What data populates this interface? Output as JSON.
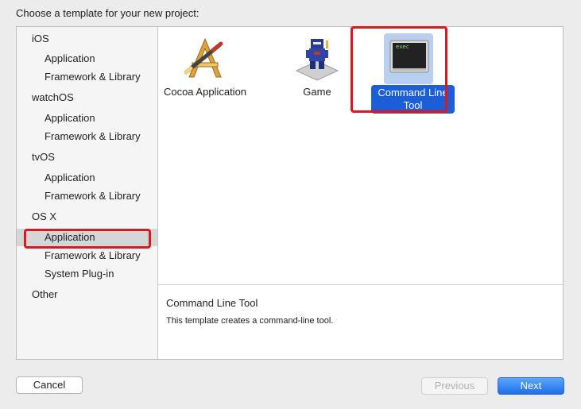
{
  "heading": "Choose a template for your new project:",
  "sidebar": {
    "items": [
      {
        "label": "iOS",
        "kind": "platform"
      },
      {
        "label": "Application",
        "kind": "sub"
      },
      {
        "label": "Framework & Library",
        "kind": "sub"
      },
      {
        "label": "watchOS",
        "kind": "platform"
      },
      {
        "label": "Application",
        "kind": "sub"
      },
      {
        "label": "Framework & Library",
        "kind": "sub"
      },
      {
        "label": "tvOS",
        "kind": "platform"
      },
      {
        "label": "Application",
        "kind": "sub"
      },
      {
        "label": "Framework & Library",
        "kind": "sub"
      },
      {
        "label": "OS X",
        "kind": "platform"
      },
      {
        "label": "Application",
        "kind": "sub",
        "selected": true
      },
      {
        "label": "Framework & Library",
        "kind": "sub"
      },
      {
        "label": "System Plug-in",
        "kind": "sub"
      },
      {
        "label": "Other",
        "kind": "platform"
      }
    ]
  },
  "templates": [
    {
      "label": "Cocoa Application",
      "icon": "cocoa-app-icon"
    },
    {
      "label": "Game",
      "icon": "game-icon"
    },
    {
      "label": "Command Line Tool",
      "icon": "terminal-icon",
      "selected": true,
      "icon_text": "exec"
    }
  ],
  "description": {
    "title": "Command Line Tool",
    "text": "This template creates a command-line tool."
  },
  "buttons": {
    "cancel": "Cancel",
    "previous": "Previous",
    "next": "Next"
  },
  "colors": {
    "selection_blue": "#1b5ed8",
    "highlight_red": "#d9191f",
    "next_button": "#1d6fe8"
  }
}
